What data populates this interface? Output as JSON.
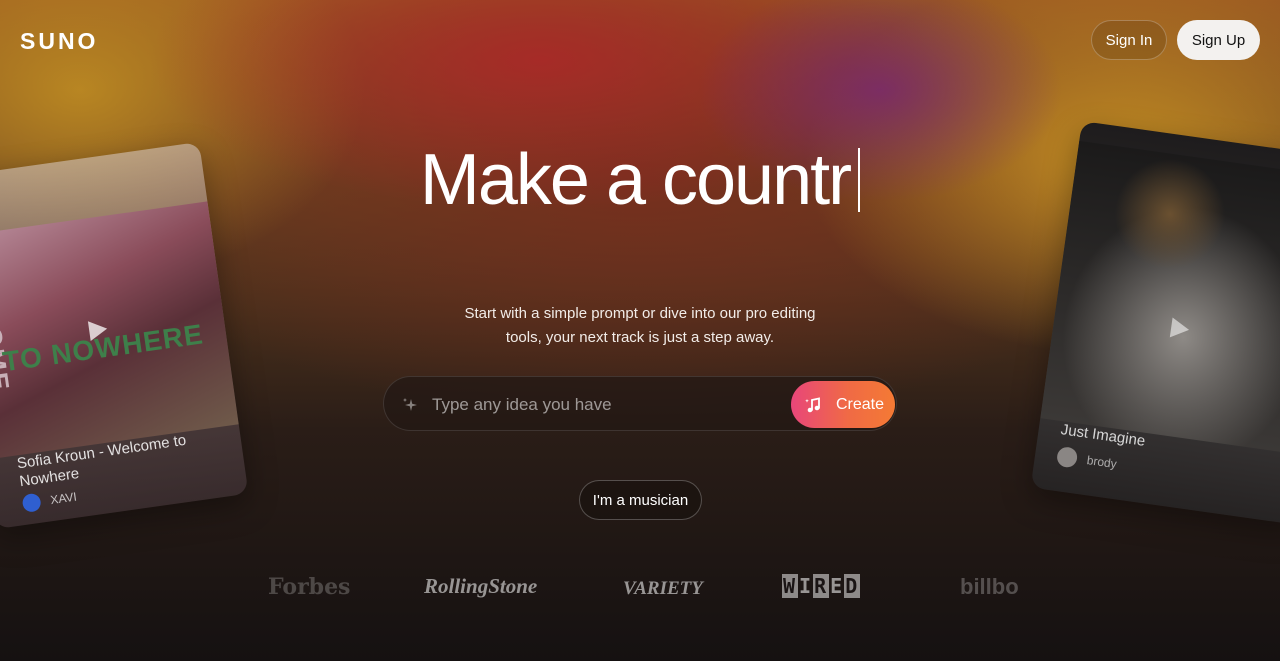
{
  "brand": {
    "logo": "SUNO"
  },
  "nav": {
    "sign_in": "Sign In",
    "sign_up": "Sign Up"
  },
  "hero": {
    "headline": "Make a countr",
    "subtitle_line1": "Start with a simple prompt or dive into our pro editing",
    "subtitle_line2": "tools, your next track is just a step away."
  },
  "prompt": {
    "placeholder": "Type any idea you have",
    "value": "",
    "create_label": "Create"
  },
  "secondary": {
    "musician_label": "I'm a musician"
  },
  "cards": {
    "left": {
      "cover_text": "TO NOWHERE",
      "cover_vertical": "WELCOME",
      "title": "Sofia Kroun - Welcome to Nowhere",
      "artist": "XAVI"
    },
    "right": {
      "title": "Just Imagine",
      "artist": "brody"
    }
  },
  "press": {
    "logos": [
      "Forbes",
      "RollingStone",
      "VARIETY",
      "WIRED",
      "billbo"
    ]
  },
  "colors": {
    "create_gradient_start": "#e8467a",
    "create_gradient_end": "#f47a34",
    "signup_bg": "#f3f1ef"
  }
}
